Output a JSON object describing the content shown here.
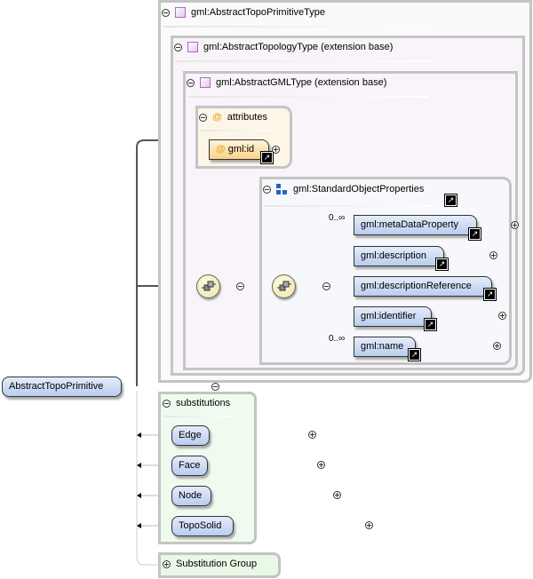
{
  "root": {
    "label": "AbstractTopoPrimitive"
  },
  "type": {
    "label": "gml:AbstractTopoPrimitiveType",
    "icon": "complex-type-icon"
  },
  "base1": {
    "label": "gml:AbstractTopologyType (extension base)",
    "icon": "complex-type-icon"
  },
  "base2": {
    "label": "gml:AbstractGMLType (extension base)",
    "icon": "complex-type-icon"
  },
  "attributes": {
    "label": "attributes",
    "icon": "at-icon",
    "items": [
      {
        "label": "gml:id"
      }
    ]
  },
  "group": {
    "label": "gml:StandardObjectProperties",
    "icon": "group-icon"
  },
  "elements": [
    {
      "label": "gml:metaDataProperty",
      "cardinality": "0..∞"
    },
    {
      "label": "gml:description",
      "cardinality": ""
    },
    {
      "label": "gml:descriptionReference",
      "cardinality": ""
    },
    {
      "label": "gml:identifier",
      "cardinality": ""
    },
    {
      "label": "gml:name",
      "cardinality": "0..∞"
    }
  ],
  "substitutions": {
    "label": "substitutions",
    "items": [
      {
        "label": "Edge"
      },
      {
        "label": "Face"
      },
      {
        "label": "Node"
      },
      {
        "label": "TopoSolid"
      }
    ]
  },
  "substitution_group": {
    "label": "Substitution Group"
  },
  "colors": {
    "element": "#c3d4f2",
    "attribute": "#fbd38a",
    "substitutions_bg": "#f0fbef",
    "type_bg": "#f8f4f9"
  }
}
